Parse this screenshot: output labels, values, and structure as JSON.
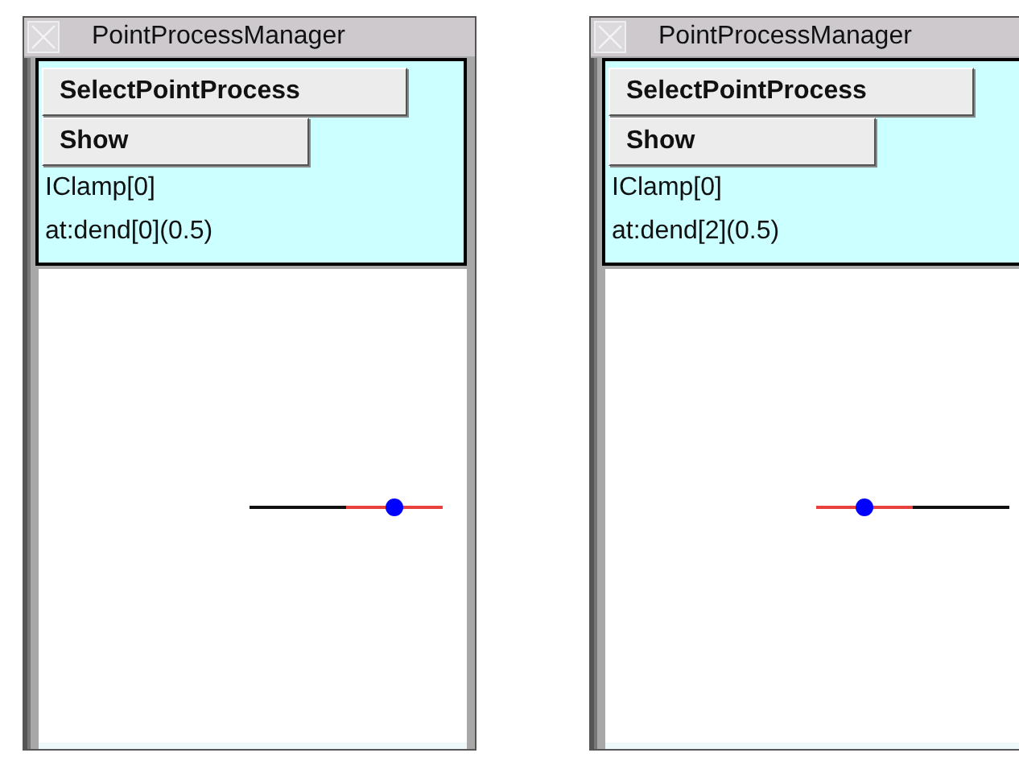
{
  "windows": [
    {
      "title": "PointProcessManager",
      "buttons": [
        "SelectPointProcess",
        "Show"
      ],
      "lines": [
        "IClamp[0]",
        "at:dend[0](0.5)"
      ],
      "segments": [
        {
          "selected": false
        },
        {
          "selected": true
        }
      ]
    },
    {
      "title": "PointProcessManager",
      "buttons": [
        "SelectPointProcess",
        "Show"
      ],
      "lines": [
        "IClamp[0]",
        "at:dend[2](0.5)"
      ],
      "segments": [
        {
          "selected": true
        },
        {
          "selected": false
        }
      ]
    }
  ]
}
